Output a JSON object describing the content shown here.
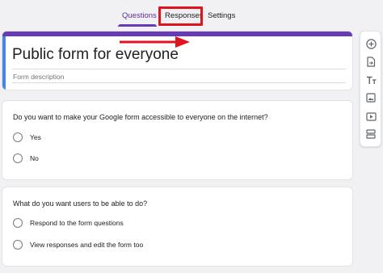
{
  "tabs": {
    "questions": "Questions",
    "responses": "Responses",
    "settings": "Settings"
  },
  "form": {
    "title": "Public form for everyone",
    "description_placeholder": "Form description"
  },
  "questions": [
    {
      "text": "Do you want to make your Google form accessible to everyone  on the internet?",
      "options": [
        "Yes",
        "No"
      ]
    },
    {
      "text": "What do you want users to be able to do?",
      "options": [
        "Respond to the form questions",
        "View responses and edit the form too"
      ]
    }
  ],
  "toolbar": {
    "icons": [
      "add-question-icon",
      "import-questions-icon",
      "add-title-icon",
      "add-image-icon",
      "add-video-icon",
      "add-section-icon"
    ]
  },
  "colors": {
    "accent": "#673ab7",
    "highlight": "#e0141e",
    "title_left_bar": "#4285f4"
  }
}
